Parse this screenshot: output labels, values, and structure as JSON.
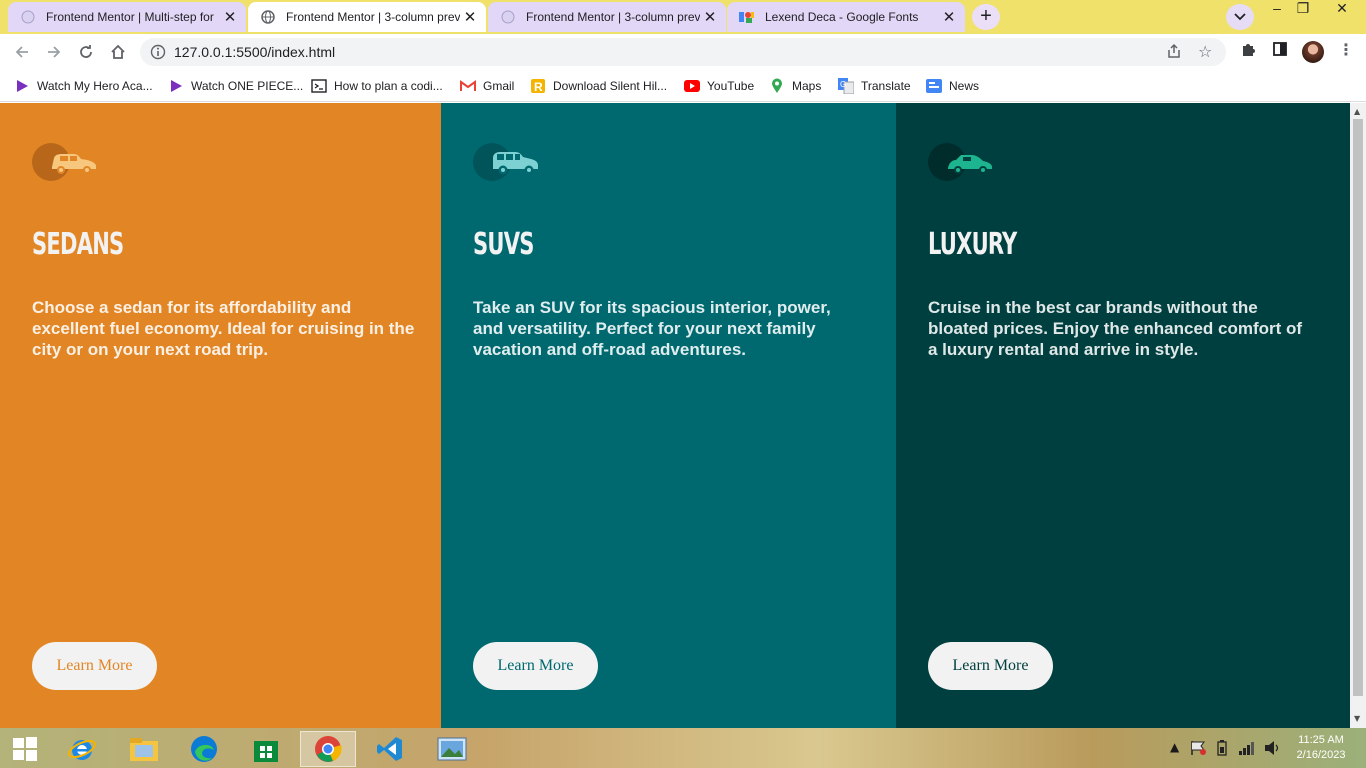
{
  "browser": {
    "tabs": [
      {
        "title": "Frontend Mentor | Multi-step for",
        "active": false
      },
      {
        "title": "Frontend Mentor | 3-column prev",
        "active": true
      },
      {
        "title": "Frontend Mentor | 3-column prev",
        "active": false
      },
      {
        "title": "Lexend Deca - Google Fonts",
        "active": false
      }
    ],
    "new_tab_label": "+",
    "url": "127.0.0.1:5500/index.html",
    "bookmarks": [
      {
        "label": "Watch My Hero Aca...",
        "icon": "play-icon"
      },
      {
        "label": "Watch ONE PIECE...",
        "icon": "play-icon"
      },
      {
        "label": "How to plan a codi...",
        "icon": "terminal-icon"
      },
      {
        "label": "Gmail",
        "icon": "gmail-icon"
      },
      {
        "label": "Download Silent Hil...",
        "icon": "r-icon"
      },
      {
        "label": "YouTube",
        "icon": "youtube-icon"
      },
      {
        "label": "Maps",
        "icon": "maps-icon"
      },
      {
        "label": "Translate",
        "icon": "translate-icon"
      },
      {
        "label": "News",
        "icon": "news-icon"
      }
    ]
  },
  "cards": [
    {
      "title": "SEDANS",
      "text": "Choose a sedan for its affordability and excellent fuel economy. Ideal for cruising in the city or on your next road trip.",
      "button": "Learn More",
      "icon": "sedan-car-icon",
      "bg": "#e28625",
      "button_text_color": "#e28625"
    },
    {
      "title": "SUVS",
      "text": "Take an SUV for its spacious interior, power, and versatility. Perfect for your next family vacation and off-road adventures.",
      "button": "Learn More",
      "icon": "suv-car-icon",
      "bg": "#006970",
      "button_text_color": "#006970"
    },
    {
      "title": "LUXURY",
      "text": "Cruise in the best car brands without the bloated prices. Enjoy the enhanced comfort of a luxury rental and arrive in style.",
      "button": "Learn More",
      "icon": "luxury-car-icon",
      "bg": "#003f3f",
      "button_text_color": "#003f3f"
    }
  ],
  "taskbar": {
    "time": "11:25 AM",
    "date": "2/16/2023"
  }
}
